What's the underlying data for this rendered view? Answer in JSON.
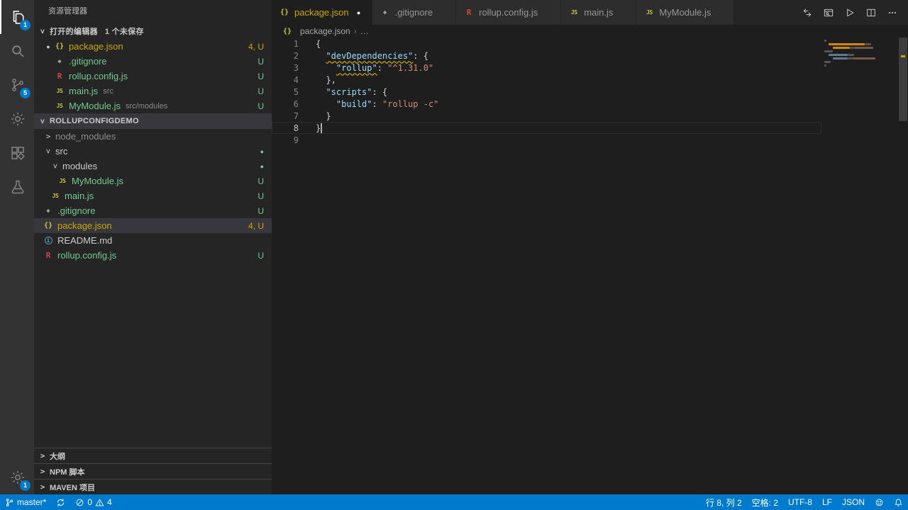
{
  "colors": {
    "accent": "#007acc",
    "warning": "#cca700",
    "untracked": "#73c991",
    "default": "#cccccc",
    "ignored": "#8c8c8c"
  },
  "activity_bar": {
    "items": [
      {
        "name": "explorer",
        "icon": "files",
        "badge": "1",
        "active": true
      },
      {
        "name": "search",
        "icon": "search"
      },
      {
        "name": "source-control",
        "icon": "scm",
        "badge": "5"
      },
      {
        "name": "settings",
        "icon": "gear"
      },
      {
        "name": "extensions",
        "icon": "extensions"
      },
      {
        "name": "test-explorer",
        "icon": "beaker"
      }
    ],
    "bottom_items": [
      {
        "name": "manage",
        "icon": "gear",
        "badge": "1"
      }
    ]
  },
  "sidebar": {
    "title": "资源管理器",
    "open_editors": {
      "header": "打开的编辑器",
      "badge": "1 个未保存",
      "items": [
        {
          "icon": "json",
          "label": "package.json",
          "decoration": "4, U",
          "dirty": true,
          "color": "warning"
        },
        {
          "icon": "gitignore",
          "label": ".gitignore",
          "decoration": "U",
          "color": "untracked"
        },
        {
          "icon": "rollup",
          "label": "rollup.config.js",
          "decoration": "U",
          "color": "untracked"
        },
        {
          "icon": "js",
          "label": "main.js",
          "detail": "src",
          "decoration": "U",
          "color": "untracked"
        },
        {
          "icon": "js",
          "label": "MyModule.js",
          "detail": "src/modules",
          "decoration": "U",
          "color": "untracked"
        }
      ]
    },
    "explorer_section": {
      "header": "ROLLUPCONFIGDEMO",
      "items": [
        {
          "type": "folder",
          "label": "node_modules",
          "level": 0,
          "expanded": false,
          "color": "ignored"
        },
        {
          "type": "folder",
          "label": "src",
          "level": 0,
          "expanded": true,
          "color": "default",
          "decoration": "●",
          "decoration_color": "untracked"
        },
        {
          "type": "folder",
          "label": "modules",
          "level": 1,
          "expanded": true,
          "color": "default",
          "decoration": "●",
          "decoration_color": "untracked"
        },
        {
          "type": "file",
          "icon": "js",
          "label": "MyModule.js",
          "level": 2,
          "decoration": "U",
          "color": "untracked"
        },
        {
          "type": "file",
          "icon": "js",
          "label": "main.js",
          "level": 1,
          "decoration": "U",
          "color": "untracked"
        },
        {
          "type": "file",
          "icon": "gitignore",
          "label": ".gitignore",
          "level": 0,
          "decoration": "U",
          "color": "untracked"
        },
        {
          "type": "file",
          "icon": "json",
          "label": "package.json",
          "level": 0,
          "decoration": "4, U",
          "color": "warning",
          "selected": true
        },
        {
          "type": "file",
          "icon": "markdown",
          "label": "README.md",
          "level": 0,
          "color": "default"
        },
        {
          "type": "file",
          "icon": "rollup",
          "label": "rollup.config.js",
          "level": 0,
          "decoration": "U",
          "color": "untracked"
        }
      ]
    },
    "bottom_sections": [
      {
        "label": "大纲"
      },
      {
        "label": "NPM 脚本"
      },
      {
        "label": "MAVEN 项目"
      }
    ]
  },
  "editor": {
    "tabs": [
      {
        "icon": "json",
        "label": "package.json",
        "active": true,
        "dirty": true,
        "color": "warning"
      },
      {
        "icon": "gitignore",
        "label": ".gitignore"
      },
      {
        "icon": "rollup",
        "label": "rollup.config.js"
      },
      {
        "icon": "js",
        "label": "main.js"
      },
      {
        "icon": "js",
        "label": "MyModule.js"
      }
    ],
    "actions": [
      {
        "name": "open-changes",
        "icon": "compare"
      },
      {
        "name": "open-preview",
        "icon": "preview"
      },
      {
        "name": "run-code",
        "icon": "play"
      },
      {
        "name": "split-editor",
        "icon": "split"
      },
      {
        "name": "more-actions",
        "icon": "ellipsis"
      }
    ],
    "breadcrumb": {
      "file_icon": "json",
      "file": "package.json",
      "separator": "›",
      "symbol": "…"
    },
    "code": {
      "language": "json",
      "lines": [
        {
          "num": "1",
          "tokens": [
            {
              "text": "{",
              "type": "punct"
            }
          ]
        },
        {
          "num": "2",
          "tokens": [
            {
              "text": "  ",
              "type": "punct"
            },
            {
              "text": "\"devDependencies\"",
              "type": "key",
              "warn": true
            },
            {
              "text": ": {",
              "type": "punct"
            }
          ]
        },
        {
          "num": "3",
          "tokens": [
            {
              "text": "    ",
              "type": "punct"
            },
            {
              "text": "\"rollup\"",
              "type": "key",
              "warn": true
            },
            {
              "text": ": ",
              "type": "punct"
            },
            {
              "text": "\"^1.31.0\"",
              "type": "str"
            }
          ]
        },
        {
          "num": "4",
          "tokens": [
            {
              "text": "  },",
              "type": "punct"
            }
          ]
        },
        {
          "num": "5",
          "tokens": [
            {
              "text": "  ",
              "type": "punct"
            },
            {
              "text": "\"scripts\"",
              "type": "key"
            },
            {
              "text": ": {",
              "type": "punct"
            }
          ]
        },
        {
          "num": "6",
          "tokens": [
            {
              "text": "    ",
              "type": "punct"
            },
            {
              "text": "\"build\"",
              "type": "key"
            },
            {
              "text": ": ",
              "type": "punct"
            },
            {
              "text": "\"rollup -c\"",
              "type": "str"
            }
          ]
        },
        {
          "num": "7",
          "tokens": [
            {
              "text": "  }",
              "type": "punct"
            }
          ]
        },
        {
          "num": "8",
          "tokens": [
            {
              "text": "}",
              "type": "punct"
            }
          ],
          "cursor": true,
          "active": true
        },
        {
          "num": "9",
          "tokens": []
        }
      ]
    }
  },
  "status_bar": {
    "left": [
      {
        "name": "git-branch",
        "icon": "branch",
        "label": "master*"
      },
      {
        "name": "sync",
        "icon": "sync"
      },
      {
        "name": "problems",
        "parts": [
          {
            "icon": "error",
            "label": "0"
          },
          {
            "icon": "warning",
            "label": "4"
          }
        ]
      }
    ],
    "right": [
      {
        "name": "cursor-position",
        "label": "行 8, 列 2"
      },
      {
        "name": "indentation",
        "label": "空格: 2"
      },
      {
        "name": "encoding",
        "label": "UTF-8"
      },
      {
        "name": "eol",
        "label": "LF"
      },
      {
        "name": "language-mode",
        "label": "JSON"
      },
      {
        "name": "feedback",
        "icon": "feedback"
      },
      {
        "name": "notifications",
        "icon": "bell"
      }
    ]
  }
}
